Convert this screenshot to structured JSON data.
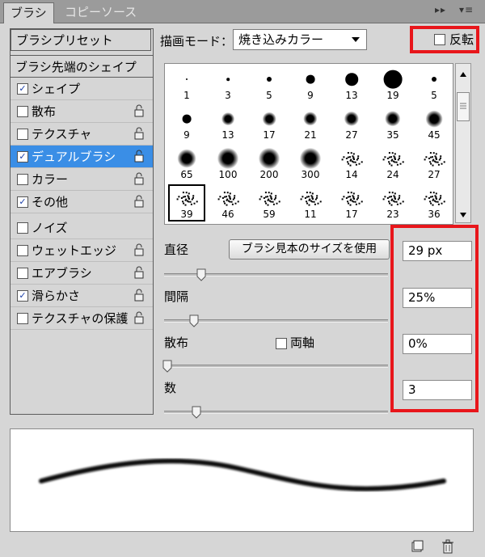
{
  "tabs": [
    {
      "label": "ブラシ",
      "active": true
    },
    {
      "label": "コピーソース",
      "active": false
    }
  ],
  "panel_controls": {
    "collapse": "▸▸",
    "menu": "▾≡"
  },
  "left_panel": {
    "presets_button": "ブラシプリセット",
    "tip_shape": "ブラシ先端のシェイプ",
    "options": [
      {
        "label": "シェイプ",
        "checked": true,
        "selected": false
      },
      {
        "label": "散布",
        "checked": false,
        "selected": false
      },
      {
        "label": "テクスチャ",
        "checked": false,
        "selected": false
      },
      {
        "label": "デュアルブラシ",
        "checked": true,
        "selected": true
      },
      {
        "label": "カラー",
        "checked": false,
        "selected": false
      },
      {
        "label": "その他",
        "checked": true,
        "selected": false
      },
      {
        "label": "ノイズ",
        "checked": false,
        "selected": false
      },
      {
        "label": "ウェットエッジ",
        "checked": false,
        "selected": false
      },
      {
        "label": "エアブラシ",
        "checked": false,
        "selected": false
      },
      {
        "label": "滑らかさ",
        "checked": true,
        "selected": false
      },
      {
        "label": "テクスチャの保護",
        "checked": false,
        "selected": false
      }
    ]
  },
  "mode": {
    "label": "描画モード：",
    "value": "焼き込みカラー"
  },
  "invert": {
    "label": "反転",
    "checked": false
  },
  "brush_tips": [
    {
      "size": "1",
      "style": "hard"
    },
    {
      "size": "3",
      "style": "hard"
    },
    {
      "size": "5",
      "style": "hard"
    },
    {
      "size": "9",
      "style": "hard"
    },
    {
      "size": "13",
      "style": "hard"
    },
    {
      "size": "19",
      "style": "hard"
    },
    {
      "size": "5",
      "style": "hard"
    },
    {
      "size": "9",
      "style": "hard"
    },
    {
      "size": "13",
      "style": "soft"
    },
    {
      "size": "17",
      "style": "soft"
    },
    {
      "size": "21",
      "style": "soft"
    },
    {
      "size": "27",
      "style": "soft"
    },
    {
      "size": "35",
      "style": "soft"
    },
    {
      "size": "45",
      "style": "soft"
    },
    {
      "size": "65",
      "style": "soft"
    },
    {
      "size": "100",
      "style": "soft"
    },
    {
      "size": "200",
      "style": "soft"
    },
    {
      "size": "300",
      "style": "soft"
    },
    {
      "size": "14",
      "style": "scatter"
    },
    {
      "size": "24",
      "style": "scatter"
    },
    {
      "size": "27",
      "style": "scatter"
    },
    {
      "size": "39",
      "style": "scatter",
      "selected": true
    },
    {
      "size": "46",
      "style": "scatter"
    },
    {
      "size": "59",
      "style": "scatter"
    },
    {
      "size": "11",
      "style": "scatter"
    },
    {
      "size": "17",
      "style": "scatter"
    },
    {
      "size": "23",
      "style": "scatter"
    },
    {
      "size": "36",
      "style": "scatter"
    },
    {
      "size": "",
      "style": "scatter"
    },
    {
      "size": "",
      "style": "scatter"
    },
    {
      "size": "",
      "style": "scatter"
    },
    {
      "size": "",
      "style": "scatter"
    },
    {
      "size": "",
      "style": "scatter"
    },
    {
      "size": "",
      "style": "scatter"
    },
    {
      "size": "",
      "style": "scatter"
    }
  ],
  "diameter": {
    "label": "直径",
    "button": "ブラシ見本のサイズを使用",
    "value": "29 px",
    "slider": 0.15
  },
  "spacing": {
    "label": "間隔",
    "value": "25%",
    "slider": 0.12
  },
  "scatter": {
    "label": "散布",
    "both_axes_label": "両軸",
    "both_axes": false,
    "value": "0%",
    "slider": 0.0
  },
  "count": {
    "label": "数",
    "value": "3",
    "slider": 0.13
  },
  "icons": {
    "new": "new-brush-icon",
    "delete": "trash-icon",
    "lock": "lock-icon"
  }
}
